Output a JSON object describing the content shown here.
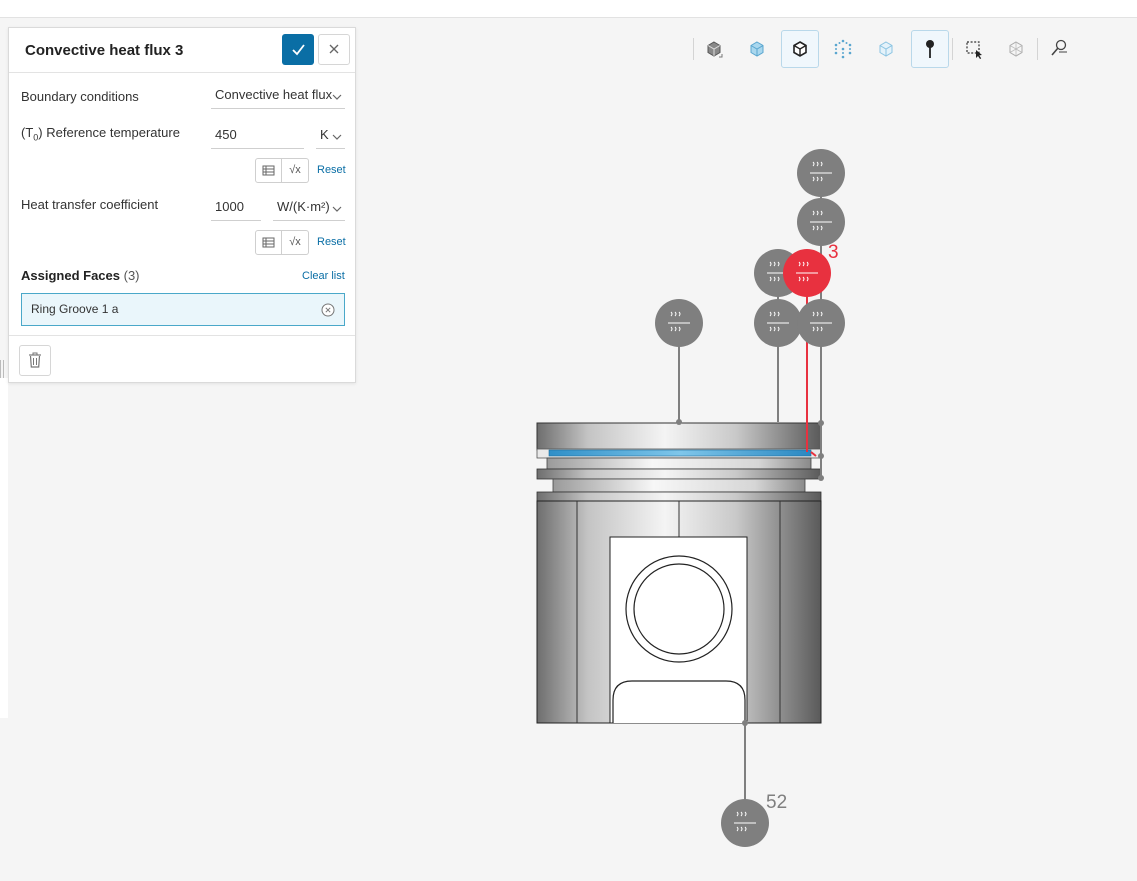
{
  "panel": {
    "title": "Convective heat flux 3",
    "boundary_conditions_label": "Boundary conditions",
    "boundary_conditions_value": "Convective heat flux",
    "ref_temp_label_prefix": "(T",
    "ref_temp_label_sub": "0",
    "ref_temp_label_suffix": ") Reference temperature",
    "ref_temp_value": "450",
    "ref_temp_unit": "K",
    "htc_label": "Heat transfer coefficient",
    "htc_value": "1000",
    "htc_unit": "W/(K·m²)",
    "reset_label": "Reset",
    "formula_symbol": "√x",
    "assigned_faces_label": "Assigned Faces",
    "assigned_faces_count": "(3)",
    "clear_list_label": "Clear list",
    "assigned_faces": [
      "Ring Groove 1 a"
    ]
  },
  "toolbar": {
    "tools": [
      {
        "name": "view-cube-tool",
        "active": false
      },
      {
        "name": "iso-view-tool",
        "active": false
      },
      {
        "name": "solid-view-tool",
        "active": true
      },
      {
        "name": "point-select-tool",
        "active": false
      },
      {
        "name": "transparent-view-tool",
        "active": false
      },
      {
        "name": "pin-tool",
        "active": true
      },
      {
        "name": "box-select-tool",
        "active": false
      },
      {
        "name": "mesh-hide-tool",
        "active": false
      },
      {
        "name": "probe-tool",
        "active": false
      }
    ]
  },
  "viewer": {
    "selected_marker_label": "3",
    "bottom_marker_label": "52",
    "marker_color": "#7f7f7f",
    "selected_marker_color": "#e8313f",
    "highlight_color": "#3aa0d8"
  },
  "colors": {
    "accent": "#0a6ea5",
    "selection_bg": "#eaf6fb"
  }
}
